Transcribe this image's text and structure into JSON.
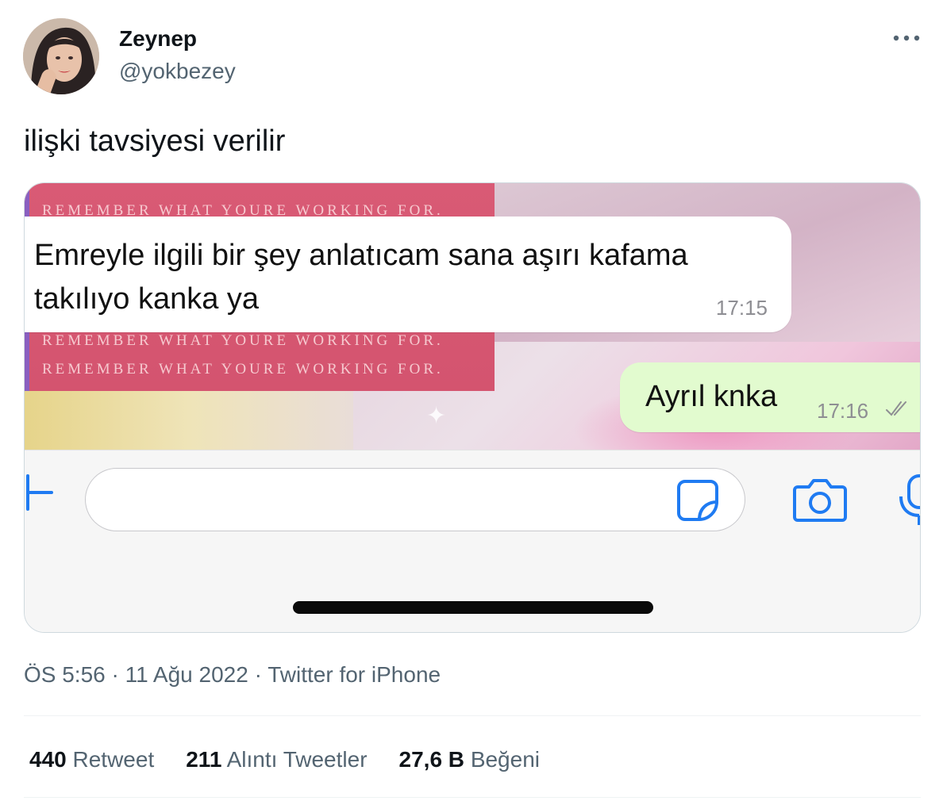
{
  "tweet": {
    "display_name": "Zeynep",
    "username": "@yokbezey",
    "text": "ilişki tavsiyesi verilir",
    "more_icon": "more-horizontal-icon"
  },
  "screenshot": {
    "background_text": "REMEMBER WHAT YOURE WORKING FOR.",
    "incoming": {
      "text": "Emreyle ilgili bir şey anlatıcam sana aşırı kafama takılıyo kanka ya",
      "time": "17:15"
    },
    "outgoing": {
      "text": "Ayrıl knka",
      "time": "17:16",
      "status_icon": "double-check-icon"
    },
    "input_bar": {
      "icons": [
        "plus-icon",
        "sticker-icon",
        "camera-icon",
        "microphone-icon"
      ],
      "accent_color": "#1f7bf2"
    }
  },
  "meta": {
    "time": "ÖS 5:56",
    "separator": "·",
    "date": "11 Ağu 2022",
    "source": "Twitter for iPhone"
  },
  "stats": [
    {
      "count": "440",
      "label": "Retweet"
    },
    {
      "count": "211",
      "label": "Alıntı Tweetler"
    },
    {
      "count": "27,6 B",
      "label": "Beğeni"
    }
  ]
}
